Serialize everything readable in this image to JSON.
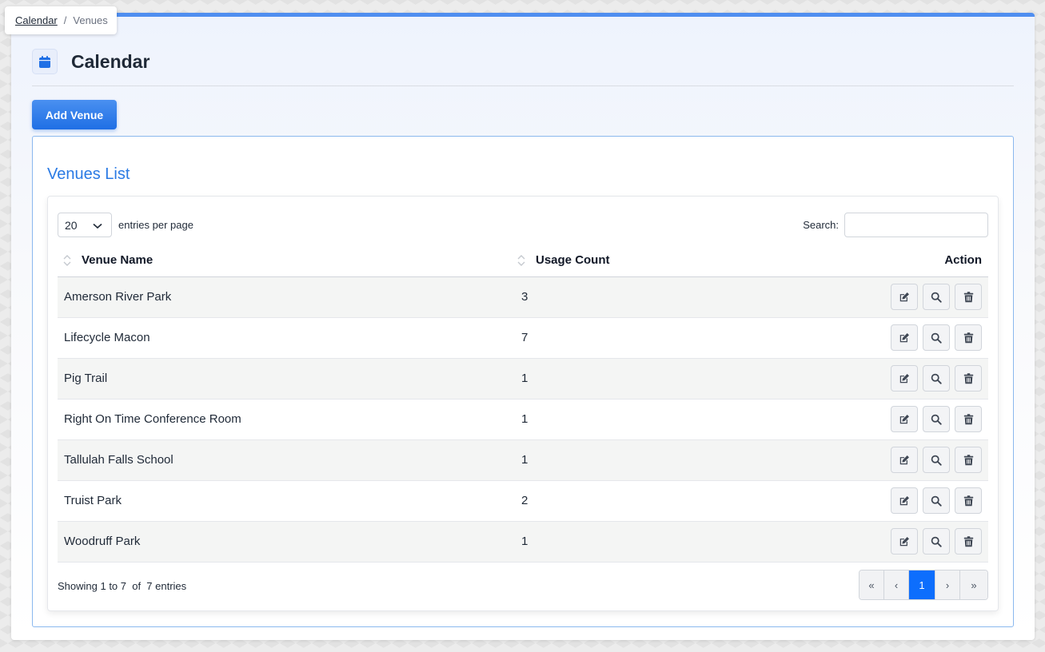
{
  "breadcrumb": {
    "parent": "Calendar",
    "separator": "/",
    "current": "Venues"
  },
  "header": {
    "title": "Calendar",
    "icon": "calendar-icon"
  },
  "toolbar": {
    "add_label": "Add Venue"
  },
  "list": {
    "title": "Venues List",
    "page_size": "20",
    "entries_label": "entries per page",
    "search_label": "Search:",
    "search_value": "",
    "columns": [
      "Venue Name",
      "Usage Count",
      "Action"
    ],
    "rows": [
      {
        "name": "Amerson River Park",
        "count": "3"
      },
      {
        "name": "Lifecycle Macon",
        "count": "7"
      },
      {
        "name": "Pig Trail",
        "count": "1"
      },
      {
        "name": "Right On Time Conference Room",
        "count": "1"
      },
      {
        "name": "Tallulah Falls School",
        "count": "1"
      },
      {
        "name": "Truist Park",
        "count": "2"
      },
      {
        "name": "Woodruff Park",
        "count": "1"
      }
    ],
    "row_actions": [
      "edit-icon",
      "search-icon",
      "trash-icon"
    ],
    "footer": "Showing 1 to 7  of  7 entries",
    "pagination": {
      "first": "«",
      "prev": "‹",
      "current": "1",
      "next": "›",
      "last": "»"
    }
  },
  "colors": {
    "accent": "#1f6fe5",
    "title_blue": "#2a7ae4",
    "active_page": "#0d6efd"
  }
}
